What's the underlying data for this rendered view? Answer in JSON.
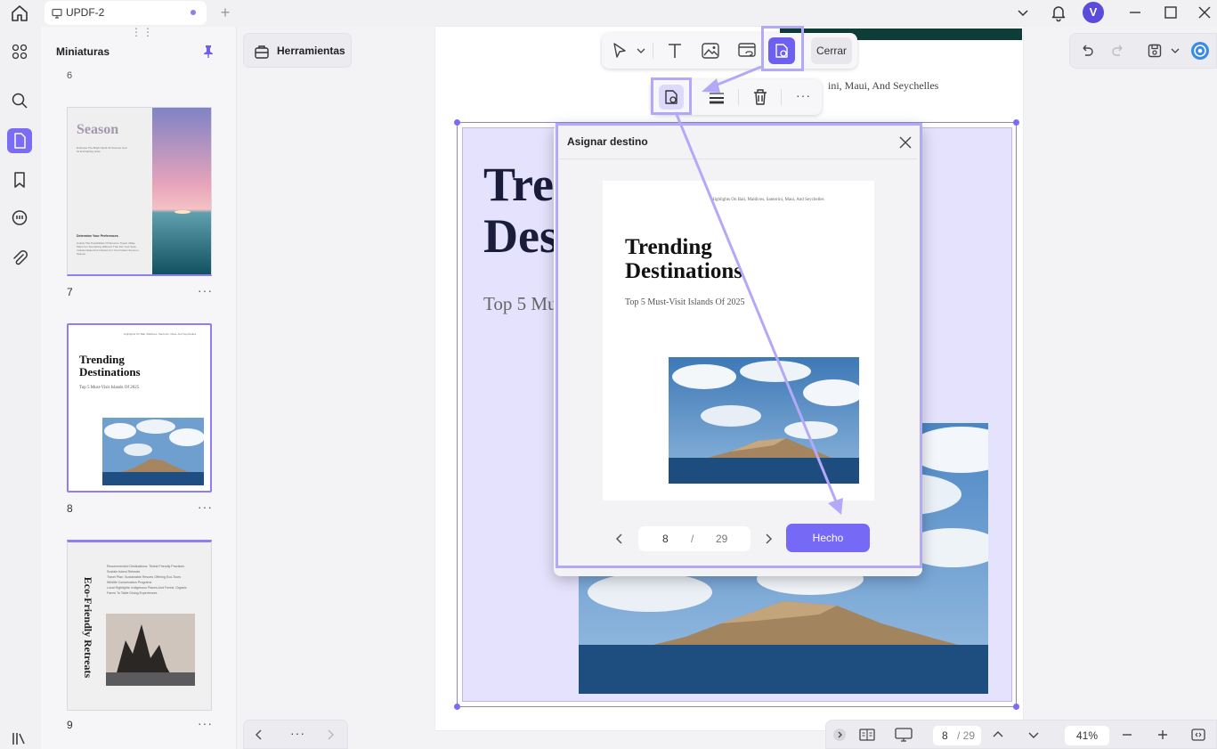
{
  "tab": {
    "title": "UPDF-2",
    "new_tab": "+"
  },
  "user": {
    "avatar_letter": "V"
  },
  "thumbnails": {
    "title": "Miniaturas",
    "prev_page_number": "6",
    "pages": [
      {
        "number": "7",
        "more": "···",
        "title": "Season",
        "intro": "Embrace The Bright Spirit Of Summer And Its Enchanting Glow",
        "section": "Determine Your Preferences",
        "body": "Unlock The Possibilities Of Summer Travel. Make Plans For Something Different That Fits Your Style. Include Ideas And Choices For Your Dream Summer Season."
      },
      {
        "number": "8",
        "more": "···",
        "header": "Highlights On Bali, Maldives, Santorini, Maui, And Seychelles",
        "title_line1": "Trending",
        "title_line2": "Destinations",
        "subtitle": "Top 5 Must-Visit Islands Of 2025"
      },
      {
        "number": "9",
        "more": "···",
        "vertical_title": "Eco-Friendly Retreats",
        "list": [
          "Recommended Destinations: Tiniest Friendly Practices",
          "Sustain Island Retreats",
          "Travel Plan: Sustainable Resorts Offering Eco-Tours",
          "Wildlife Conservation Programs",
          "Local Highlights: Indigenous Places And Forest, Organic",
          "Farms To Table Dining Experiences"
        ]
      }
    ]
  },
  "tools": {
    "herramientas": "Herramientas",
    "pager_more": "···"
  },
  "toolbar": {
    "close_label": "Cerrar",
    "more": "···"
  },
  "document": {
    "header_text": "ini, Maui, And  Seychelles",
    "title_line1": "Trending",
    "title_line2": "Destinations",
    "subtitle": "Top 5 Must-Visit Islands Of 2025"
  },
  "dialog": {
    "title": "Asignar destino",
    "preview_header": "Highlights On Bali, Maldives, Santorini, Maui, And Seychelles",
    "preview_title_line1": "Trending",
    "preview_title_line2": "Destinations",
    "preview_subtitle": "Top 5 Must-Visit Islands Of 2025",
    "current_page": "8",
    "separator": "/",
    "total_pages": "29",
    "done_label": "Hecho"
  },
  "status_bar": {
    "current_page": "8",
    "total_pages": "/ 29",
    "zoom": "41%"
  },
  "colors": {
    "accent": "#7569f5",
    "highlight": "#b3a9f9",
    "selection_fill": "#e5e2fd",
    "dark_navy": "#1a1c3a"
  }
}
